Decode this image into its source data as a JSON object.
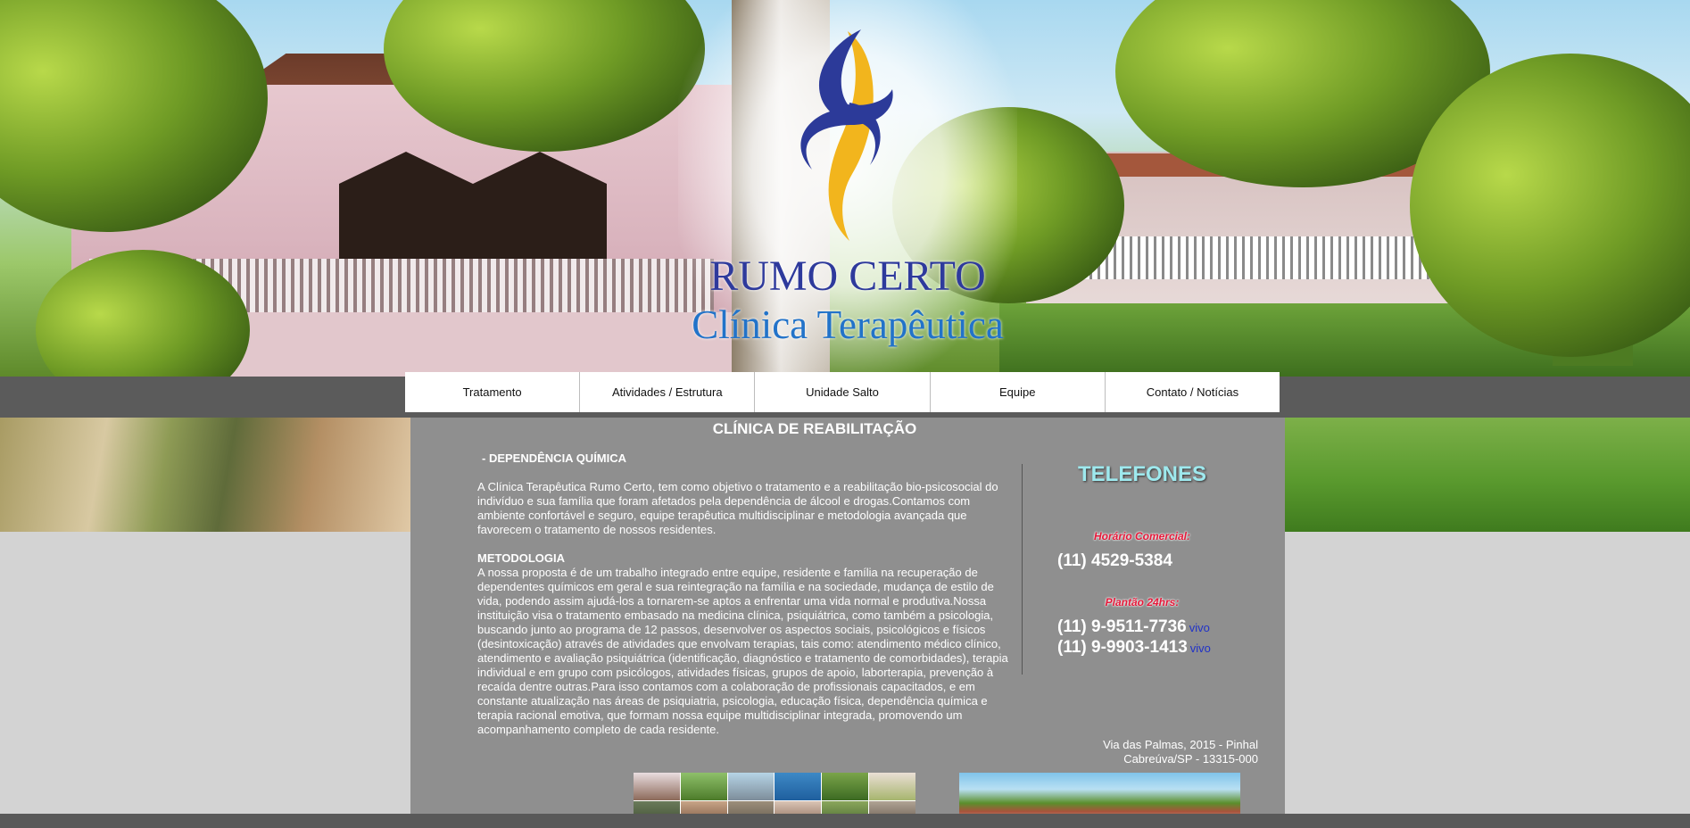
{
  "site": {
    "logo_line1": "RUMO CERTO",
    "logo_line2": "Clínica Terapêutica"
  },
  "nav": {
    "items": [
      {
        "label": "Tratamento"
      },
      {
        "label": "Atividades / Estrutura"
      },
      {
        "label": "Unidade Salto"
      },
      {
        "label": "Equipe"
      },
      {
        "label": "Contato / Notícias"
      }
    ]
  },
  "main": {
    "title": "CLÍNICA DE REABILITAÇÃO",
    "subtitle": "- DEPENDÊNCIA QUÍMICA",
    "intro": "A Clínica Terapêutica Rumo Certo, tem como objetivo o tratamento e a reabilitação bio-psicosocial do indivíduo e sua família que foram afetados pela dependência de álcool e drogas.Contamos com ambiente confortável e seguro, equipe terapêutica multidisciplinar e metodologia avançada que favorecem o tratamento de nossos residentes.",
    "method_heading": "METODOLOGIA",
    "method_text": "A nossa proposta é de um trabalho integrado entre equipe, residente e família na recuperação de dependentes químicos em geral e sua reintegração na família e na sociedade, mudança de estilo de vida, podendo assim ajudá-los a tornarem-se aptos a enfrentar uma vida normal e produtiva.Nossa instituição visa o tratamento embasado na medicina clínica, psiquiátrica, como também a psicologia, buscando junto ao programa de 12 passos, desenvolver os aspectos sociais, psicológicos e físicos (desintoxicação) através de atividades que envolvam terapias, tais como: atendimento médico clínico, atendimento e avaliação psiquiátrica (identificação, diagnóstico e tratamento de comorbidades), terapia individual e em grupo com psicólogos, atividades físicas, grupos de apoio, laborterapia, prevenção à recaída dentre outras.Para isso contamos com a colaboração de profissionais capacitados, e em constante atualização nas áreas de psiquiatria, psicologia, educação física, dependência química e terapia racional emotiva, que formam nossa equipe multidisciplinar integrada, promovendo um acompanhamento completo de cada residente."
  },
  "phones": {
    "title": "TELEFONES",
    "business_label": "Horário Comercial:",
    "business_number": "(11)   4529-5384",
    "duty_label": "Plantão 24hrs:",
    "mobile1": "(11) 9-9511-7736",
    "mobile1_carrier": "vivo",
    "mobile2": "(11) 9-9903-1413",
    "mobile2_carrier": "vivo"
  },
  "address": {
    "line1": "Via das Palmas, 2015 - Pinhal",
    "line2": "Cabreúva/SP - 13315-000"
  },
  "colors": {
    "panel": "#8f8f8f",
    "nav_band": "#5b5b5b",
    "telefones_title": "#9ee9ee",
    "phone_label": "#e5193a",
    "vivo_link": "#2032c8",
    "logo_blue": "#2e3a9c",
    "logo_gold": "#f2b51d"
  }
}
